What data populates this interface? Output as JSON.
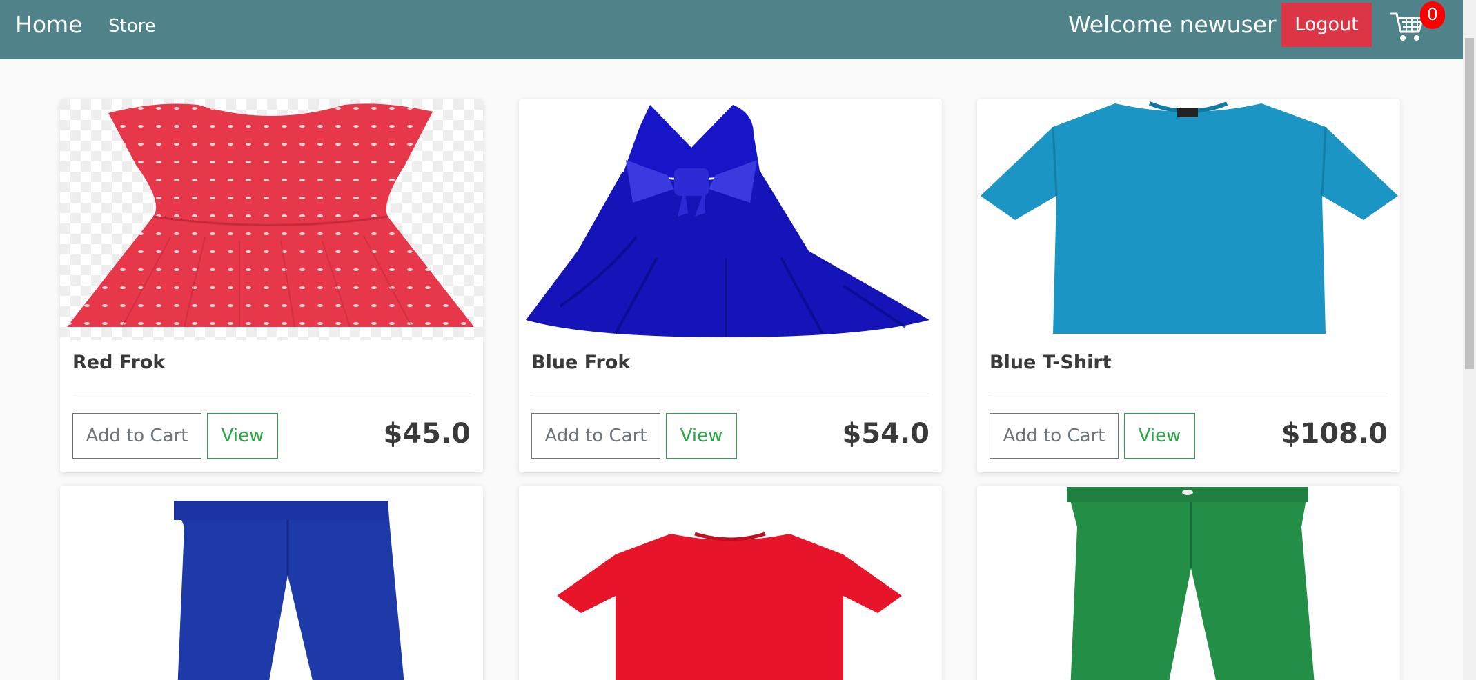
{
  "nav": {
    "home": "Home",
    "store": "Store",
    "welcome": "Welcome newuser",
    "logout": "Logout",
    "cart_count": "0"
  },
  "products": [
    {
      "name": "Red Frok",
      "price": "$45.0",
      "add_label": "Add to Cart",
      "view_label": "View",
      "image": "red-dress"
    },
    {
      "name": "Blue Frok",
      "price": "$54.0",
      "add_label": "Add to Cart",
      "view_label": "View",
      "image": "blue-dress"
    },
    {
      "name": "Blue T-Shirt",
      "price": "$108.0",
      "add_label": "Add to Cart",
      "view_label": "View",
      "image": "blue-tshirt"
    },
    {
      "image": "blue-pants"
    },
    {
      "image": "red-tshirt"
    },
    {
      "image": "green-pants"
    }
  ],
  "colors": {
    "navbar": "#508389",
    "logout": "#dc3545",
    "badge": "#ff0000",
    "view_green": "#28a745"
  }
}
